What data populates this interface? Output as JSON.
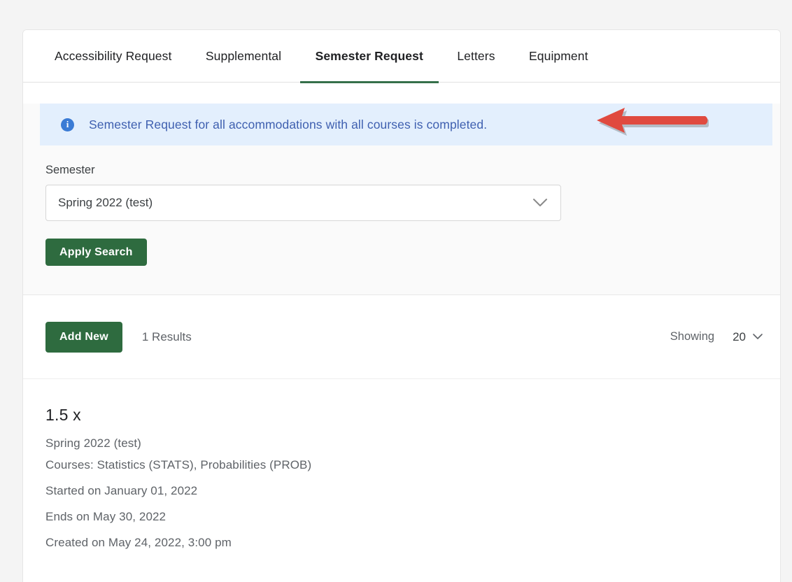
{
  "tabs": [
    {
      "label": "Accessibility Request",
      "active": false
    },
    {
      "label": "Supplemental",
      "active": false
    },
    {
      "label": "Semester Request",
      "active": true
    },
    {
      "label": "Letters",
      "active": false
    },
    {
      "label": "Equipment",
      "active": false
    }
  ],
  "banner": {
    "icon": "info-icon",
    "icon_glyph": "i",
    "text": "Semester Request for all accommodations with all courses is completed.",
    "background_color": "#e3effd",
    "text_color": "#3f60b0"
  },
  "annotation": {
    "shape": "left-arrow",
    "color": "#e04a3f"
  },
  "search": {
    "semester_label": "Semester",
    "semester_value": "Spring 2022 (test)",
    "apply_button": "Apply Search"
  },
  "toolbar": {
    "add_new_label": "Add New",
    "results_count": "1 Results",
    "showing_label": "Showing",
    "page_size": "20"
  },
  "result": {
    "title": "1.5 x",
    "semester": "Spring 2022 (test)",
    "courses": "Courses: Statistics (STATS), Probabilities (PROB)",
    "started": "Started on January 01, 2022",
    "ends": "Ends on May 30, 2022",
    "created": "Created on May 24, 2022, 3:00 pm"
  },
  "colors": {
    "primary_green": "#2e6b3f",
    "tab_underline": "#35704a",
    "page_background": "#f4f4f4"
  }
}
